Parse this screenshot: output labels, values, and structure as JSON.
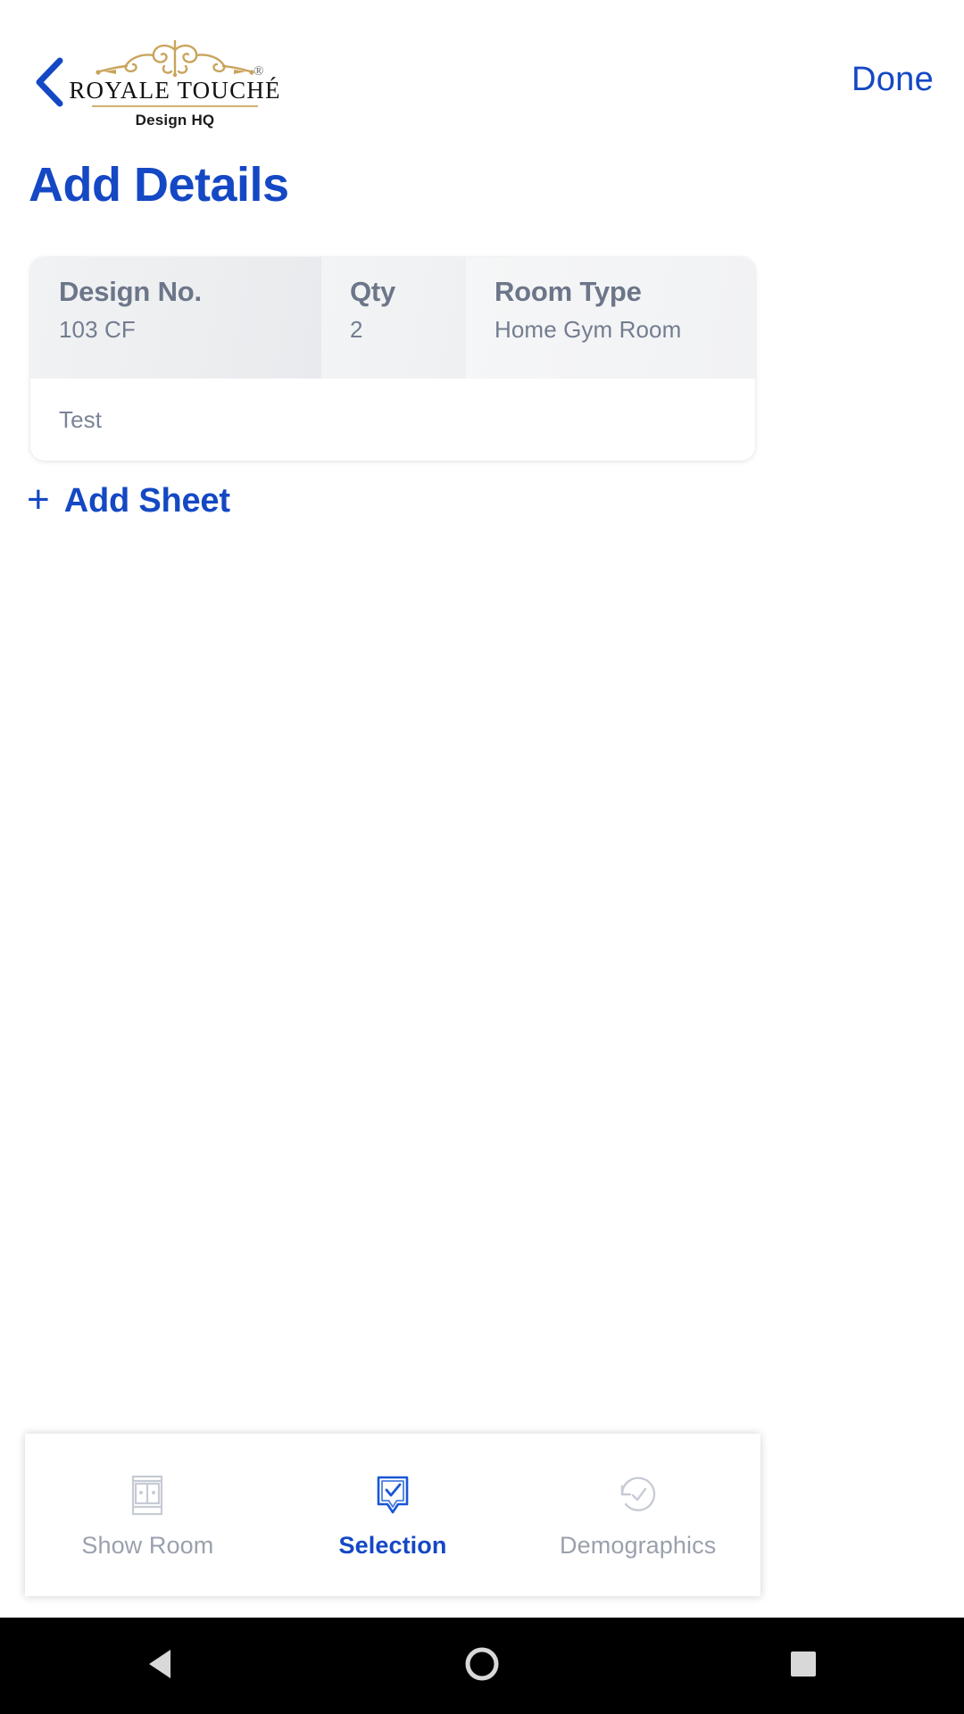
{
  "header": {
    "back_icon": "chevron-left-icon",
    "brand": {
      "flourish_icon": "ornamental-flourish-icon",
      "wordmark": "ROYALE TOUCHÉ",
      "registered_mark": "®",
      "subtitle": "Design HQ"
    },
    "done_label": "Done"
  },
  "page": {
    "title": "Add Details"
  },
  "detail_card": {
    "columns": [
      {
        "label": "Design No.",
        "value": "103 CF"
      },
      {
        "label": "Qty",
        "value": "2"
      },
      {
        "label": "Room Type",
        "value": "Home Gym Room"
      }
    ],
    "note": "Test"
  },
  "add_sheet": {
    "plus": "+",
    "label": "Add Sheet"
  },
  "tabbar": {
    "tabs": [
      {
        "label": "Show Room",
        "icon": "showroom-window-icon",
        "active": false
      },
      {
        "label": "Selection",
        "icon": "selection-check-bubble-icon",
        "active": true
      },
      {
        "label": "Demographics",
        "icon": "history-clock-icon",
        "active": false
      }
    ]
  },
  "system_nav": {
    "back_icon": "android-back-triangle-icon",
    "home_icon": "android-home-circle-icon",
    "recents_icon": "android-recents-square-icon"
  },
  "colors": {
    "accent_blue": "#1448c4",
    "muted_slate": "#6c7689",
    "value_slate": "#737d90",
    "gold": "#c9a45c",
    "inactive_gray": "#9aa1ad"
  }
}
